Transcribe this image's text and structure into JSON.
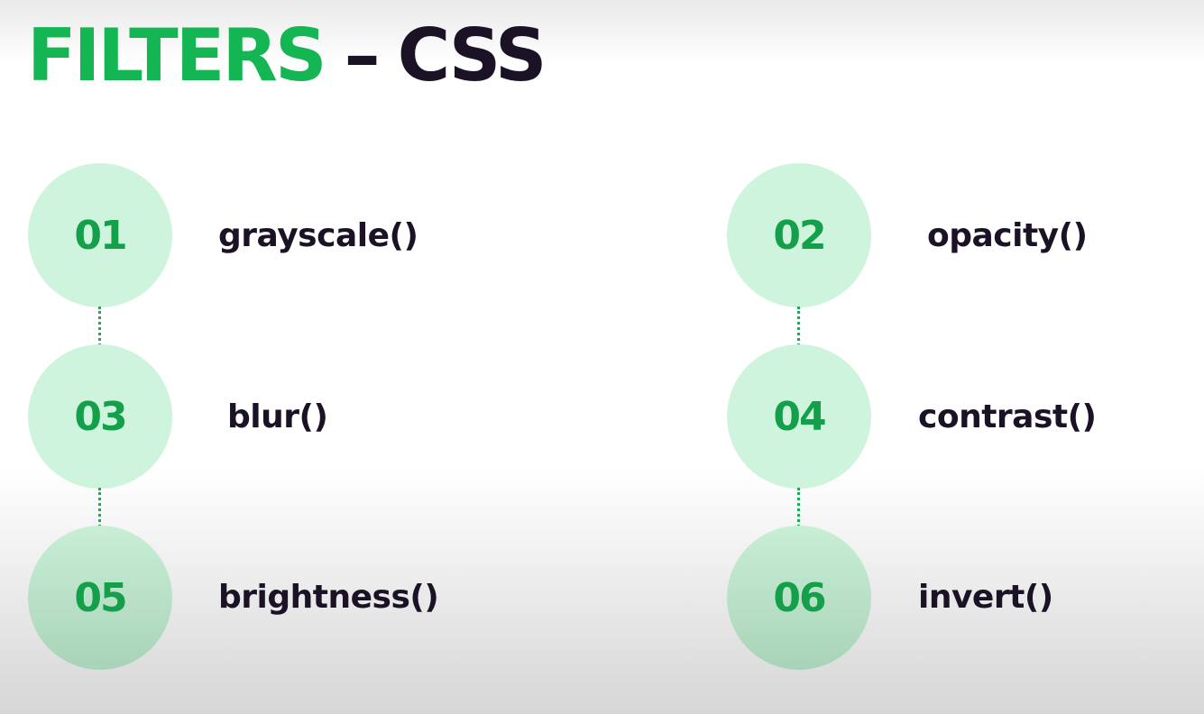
{
  "title": {
    "highlight": "FILTERS",
    "separator": "–",
    "main": "CSS"
  },
  "items": [
    {
      "number": "01",
      "label": "grayscale()"
    },
    {
      "number": "02",
      "label": "opacity()"
    },
    {
      "number": "03",
      "label": "blur()"
    },
    {
      "number": "04",
      "label": "contrast()"
    },
    {
      "number": "05",
      "label": "brightness()"
    },
    {
      "number": "06",
      "label": "invert()"
    }
  ],
  "colors": {
    "accent_green": "#14b653",
    "number_green": "#14a04a",
    "circle_fill": "#cff4dd",
    "text_dark": "#1c1226"
  }
}
